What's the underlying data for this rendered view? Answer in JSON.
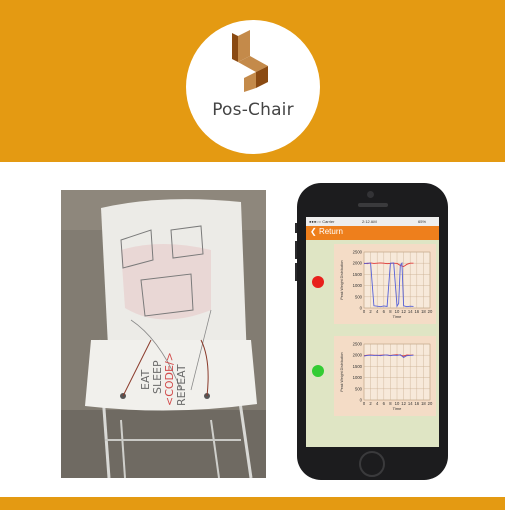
{
  "brand": {
    "name": "Pos-Chair",
    "colors": {
      "band": "#e49a12",
      "logo_light": "#c48a4a",
      "logo_dark": "#8a4a12",
      "logo_text": "#444444"
    }
  },
  "photo": {
    "slogan_lines": [
      "EAT",
      "SLEEP",
      "<CODE/>",
      "REPEAT"
    ]
  },
  "phone": {
    "status": {
      "carrier": "●●●○○ Carrier",
      "time": "2:12 AM",
      "battery": "65%"
    },
    "nav": {
      "back_label": "Return",
      "color": "#ee7f1c"
    },
    "charts": [
      {
        "status_color": "#e8201c",
        "ylabel": "Peak Weight Distribution",
        "xlabel": "Time",
        "yticks": [
          "2500",
          "2000",
          "1500",
          "1000",
          "500",
          "0"
        ],
        "xticks": [
          "0",
          "2",
          "4",
          "6",
          "8",
          "10",
          "12",
          "14",
          "16",
          "18",
          "20"
        ]
      },
      {
        "status_color": "#33cc33",
        "ylabel": "Peak Weight Distribution",
        "xlabel": "Time",
        "yticks": [
          "2500",
          "2000",
          "1500",
          "1000",
          "500",
          "0"
        ],
        "xticks": [
          "0",
          "2",
          "4",
          "6",
          "8",
          "10",
          "12",
          "14",
          "16",
          "18",
          "20"
        ]
      }
    ]
  },
  "chart_data": [
    {
      "type": "line",
      "ylabel": "Peak Weight Distribution",
      "xlabel": "Time",
      "xlim": [
        0,
        20
      ],
      "ylim": [
        0,
        2500
      ],
      "series": [
        {
          "color": "#e03a3a",
          "x": [
            0,
            1,
            2,
            3,
            4,
            5,
            6,
            7,
            8,
            9,
            10,
            11,
            12,
            13,
            14,
            15
          ],
          "values": [
            2000,
            1980,
            2010,
            1990,
            2000,
            2010,
            2000,
            1980,
            1990,
            2000,
            1990,
            1900,
            1850,
            1950,
            2000,
            2000
          ]
        },
        {
          "color": "#5560d8",
          "x": [
            0,
            1,
            2,
            3,
            4,
            5,
            6,
            7,
            8,
            9,
            10,
            10.5,
            11,
            11.5,
            12,
            13,
            14,
            15
          ],
          "values": [
            1980,
            2000,
            2000,
            100,
            80,
            60,
            90,
            70,
            2000,
            2010,
            80,
            200,
            1900,
            2000,
            100,
            60,
            80,
            70
          ]
        }
      ]
    },
    {
      "type": "line",
      "ylabel": "Peak Weight Distribution",
      "xlabel": "Time",
      "xlim": [
        0,
        20
      ],
      "ylim": [
        0,
        2500
      ],
      "series": [
        {
          "color": "#e03a3a",
          "x": [
            0,
            1,
            2,
            3,
            4,
            5,
            6,
            7,
            8,
            9,
            10,
            11,
            12,
            13,
            14,
            15
          ],
          "values": [
            1980,
            2000,
            2010,
            2000,
            1990,
            2000,
            2010,
            2000,
            1990,
            2010,
            2020,
            2000,
            1960,
            2010,
            2000,
            2010
          ]
        },
        {
          "color": "#5560d8",
          "x": [
            0,
            1,
            2,
            3,
            4,
            5,
            6,
            7,
            8,
            9,
            10,
            11,
            12,
            13,
            14,
            15
          ],
          "values": [
            1960,
            1990,
            2000,
            1990,
            2000,
            1980,
            2000,
            2010,
            1980,
            2000,
            1990,
            2020,
            1900,
            1980,
            1990,
            2000
          ]
        }
      ]
    }
  ]
}
